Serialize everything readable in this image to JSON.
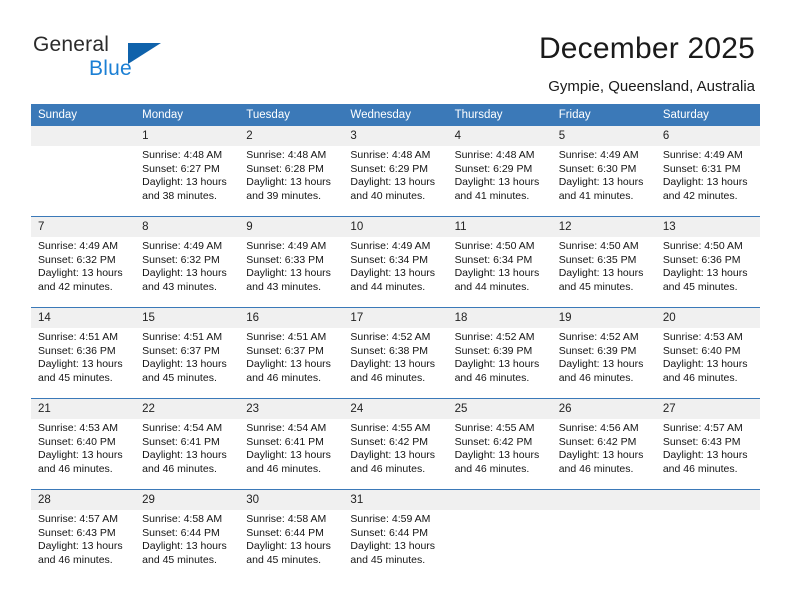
{
  "brand": {
    "name_top": "General",
    "name_bottom": "Blue",
    "triangle_color": "#0f62ab",
    "blue_text_color": "#1b7fd4"
  },
  "header": {
    "title": "December 2025",
    "location": "Gympie, Queensland, Australia",
    "accent_color": "#3b79b8"
  },
  "calendar": {
    "weekday_headers": [
      "Sunday",
      "Monday",
      "Tuesday",
      "Wednesday",
      "Thursday",
      "Friday",
      "Saturday"
    ],
    "weeks": [
      [
        {
          "day": "",
          "empty": true
        },
        {
          "day": "1",
          "sunrise": "Sunrise: 4:48 AM",
          "sunset": "Sunset: 6:27 PM",
          "daylight1": "Daylight: 13 hours",
          "daylight2": "and 38 minutes."
        },
        {
          "day": "2",
          "sunrise": "Sunrise: 4:48 AM",
          "sunset": "Sunset: 6:28 PM",
          "daylight1": "Daylight: 13 hours",
          "daylight2": "and 39 minutes."
        },
        {
          "day": "3",
          "sunrise": "Sunrise: 4:48 AM",
          "sunset": "Sunset: 6:29 PM",
          "daylight1": "Daylight: 13 hours",
          "daylight2": "and 40 minutes."
        },
        {
          "day": "4",
          "sunrise": "Sunrise: 4:48 AM",
          "sunset": "Sunset: 6:29 PM",
          "daylight1": "Daylight: 13 hours",
          "daylight2": "and 41 minutes."
        },
        {
          "day": "5",
          "sunrise": "Sunrise: 4:49 AM",
          "sunset": "Sunset: 6:30 PM",
          "daylight1": "Daylight: 13 hours",
          "daylight2": "and 41 minutes."
        },
        {
          "day": "6",
          "sunrise": "Sunrise: 4:49 AM",
          "sunset": "Sunset: 6:31 PM",
          "daylight1": "Daylight: 13 hours",
          "daylight2": "and 42 minutes."
        }
      ],
      [
        {
          "day": "7",
          "sunrise": "Sunrise: 4:49 AM",
          "sunset": "Sunset: 6:32 PM",
          "daylight1": "Daylight: 13 hours",
          "daylight2": "and 42 minutes."
        },
        {
          "day": "8",
          "sunrise": "Sunrise: 4:49 AM",
          "sunset": "Sunset: 6:32 PM",
          "daylight1": "Daylight: 13 hours",
          "daylight2": "and 43 minutes."
        },
        {
          "day": "9",
          "sunrise": "Sunrise: 4:49 AM",
          "sunset": "Sunset: 6:33 PM",
          "daylight1": "Daylight: 13 hours",
          "daylight2": "and 43 minutes."
        },
        {
          "day": "10",
          "sunrise": "Sunrise: 4:49 AM",
          "sunset": "Sunset: 6:34 PM",
          "daylight1": "Daylight: 13 hours",
          "daylight2": "and 44 minutes."
        },
        {
          "day": "11",
          "sunrise": "Sunrise: 4:50 AM",
          "sunset": "Sunset: 6:34 PM",
          "daylight1": "Daylight: 13 hours",
          "daylight2": "and 44 minutes."
        },
        {
          "day": "12",
          "sunrise": "Sunrise: 4:50 AM",
          "sunset": "Sunset: 6:35 PM",
          "daylight1": "Daylight: 13 hours",
          "daylight2": "and 45 minutes."
        },
        {
          "day": "13",
          "sunrise": "Sunrise: 4:50 AM",
          "sunset": "Sunset: 6:36 PM",
          "daylight1": "Daylight: 13 hours",
          "daylight2": "and 45 minutes."
        }
      ],
      [
        {
          "day": "14",
          "sunrise": "Sunrise: 4:51 AM",
          "sunset": "Sunset: 6:36 PM",
          "daylight1": "Daylight: 13 hours",
          "daylight2": "and 45 minutes."
        },
        {
          "day": "15",
          "sunrise": "Sunrise: 4:51 AM",
          "sunset": "Sunset: 6:37 PM",
          "daylight1": "Daylight: 13 hours",
          "daylight2": "and 45 minutes."
        },
        {
          "day": "16",
          "sunrise": "Sunrise: 4:51 AM",
          "sunset": "Sunset: 6:37 PM",
          "daylight1": "Daylight: 13 hours",
          "daylight2": "and 46 minutes."
        },
        {
          "day": "17",
          "sunrise": "Sunrise: 4:52 AM",
          "sunset": "Sunset: 6:38 PM",
          "daylight1": "Daylight: 13 hours",
          "daylight2": "and 46 minutes."
        },
        {
          "day": "18",
          "sunrise": "Sunrise: 4:52 AM",
          "sunset": "Sunset: 6:39 PM",
          "daylight1": "Daylight: 13 hours",
          "daylight2": "and 46 minutes."
        },
        {
          "day": "19",
          "sunrise": "Sunrise: 4:52 AM",
          "sunset": "Sunset: 6:39 PM",
          "daylight1": "Daylight: 13 hours",
          "daylight2": "and 46 minutes."
        },
        {
          "day": "20",
          "sunrise": "Sunrise: 4:53 AM",
          "sunset": "Sunset: 6:40 PM",
          "daylight1": "Daylight: 13 hours",
          "daylight2": "and 46 minutes."
        }
      ],
      [
        {
          "day": "21",
          "sunrise": "Sunrise: 4:53 AM",
          "sunset": "Sunset: 6:40 PM",
          "daylight1": "Daylight: 13 hours",
          "daylight2": "and 46 minutes."
        },
        {
          "day": "22",
          "sunrise": "Sunrise: 4:54 AM",
          "sunset": "Sunset: 6:41 PM",
          "daylight1": "Daylight: 13 hours",
          "daylight2": "and 46 minutes."
        },
        {
          "day": "23",
          "sunrise": "Sunrise: 4:54 AM",
          "sunset": "Sunset: 6:41 PM",
          "daylight1": "Daylight: 13 hours",
          "daylight2": "and 46 minutes."
        },
        {
          "day": "24",
          "sunrise": "Sunrise: 4:55 AM",
          "sunset": "Sunset: 6:42 PM",
          "daylight1": "Daylight: 13 hours",
          "daylight2": "and 46 minutes."
        },
        {
          "day": "25",
          "sunrise": "Sunrise: 4:55 AM",
          "sunset": "Sunset: 6:42 PM",
          "daylight1": "Daylight: 13 hours",
          "daylight2": "and 46 minutes."
        },
        {
          "day": "26",
          "sunrise": "Sunrise: 4:56 AM",
          "sunset": "Sunset: 6:42 PM",
          "daylight1": "Daylight: 13 hours",
          "daylight2": "and 46 minutes."
        },
        {
          "day": "27",
          "sunrise": "Sunrise: 4:57 AM",
          "sunset": "Sunset: 6:43 PM",
          "daylight1": "Daylight: 13 hours",
          "daylight2": "and 46 minutes."
        }
      ],
      [
        {
          "day": "28",
          "sunrise": "Sunrise: 4:57 AM",
          "sunset": "Sunset: 6:43 PM",
          "daylight1": "Daylight: 13 hours",
          "daylight2": "and 46 minutes."
        },
        {
          "day": "29",
          "sunrise": "Sunrise: 4:58 AM",
          "sunset": "Sunset: 6:44 PM",
          "daylight1": "Daylight: 13 hours",
          "daylight2": "and 45 minutes."
        },
        {
          "day": "30",
          "sunrise": "Sunrise: 4:58 AM",
          "sunset": "Sunset: 6:44 PM",
          "daylight1": "Daylight: 13 hours",
          "daylight2": "and 45 minutes."
        },
        {
          "day": "31",
          "sunrise": "Sunrise: 4:59 AM",
          "sunset": "Sunset: 6:44 PM",
          "daylight1": "Daylight: 13 hours",
          "daylight2": "and 45 minutes."
        },
        {
          "day": "",
          "empty": true
        },
        {
          "day": "",
          "empty": true
        },
        {
          "day": "",
          "empty": true
        }
      ]
    ]
  }
}
